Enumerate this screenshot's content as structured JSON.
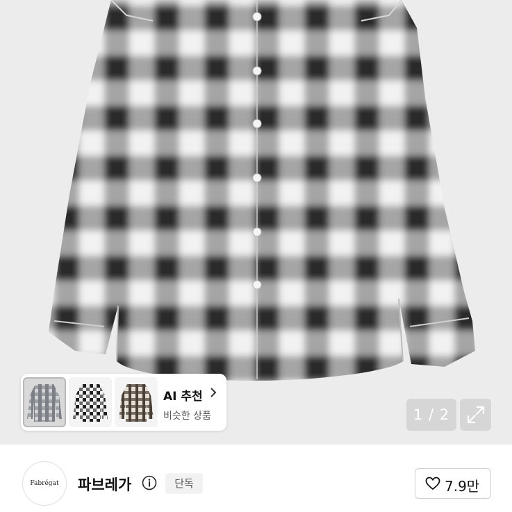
{
  "ai_recommend": {
    "title": "AI 추천",
    "subtitle": "비슷한 상품"
  },
  "gallery": {
    "counter": "1 / 2"
  },
  "seller": {
    "logo_text": "Fabrégat",
    "name": "파브레가",
    "badge": "단독"
  },
  "like": {
    "count": "7.9만"
  },
  "icons": {
    "expand": "expand-icon",
    "info": "info-icon",
    "heart": "heart-icon",
    "chevron": "chevron-right-icon"
  },
  "colors": {
    "hero_bg": "#ececec",
    "check_dark": "#3a3a3a",
    "check_light": "#f5f5f5"
  }
}
